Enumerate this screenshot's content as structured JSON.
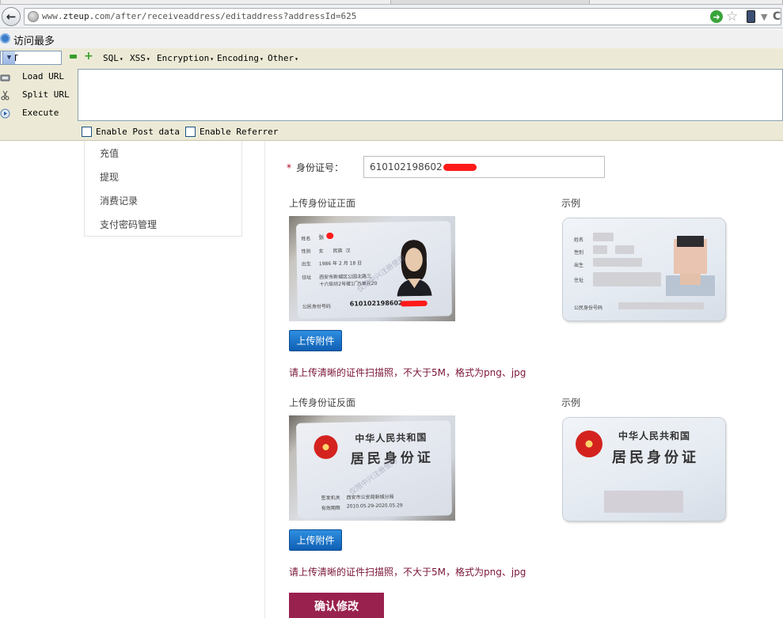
{
  "browser": {
    "url_prefix": "www.",
    "url_host": "zteup.",
    "url_rest": "com/after/receiveaddress/editaddress?addressId=625"
  },
  "bookmarks": {
    "most_visited": "访问最多"
  },
  "hackbar": {
    "select_value": "INT",
    "menus": [
      "SQL",
      "XSS",
      "Encryption",
      "Encoding",
      "Other"
    ],
    "load_url": "Load URL",
    "split_url": "Split URL",
    "execute": "Execute",
    "enable_post": "Enable Post data",
    "enable_referrer": "Enable Referrer"
  },
  "sidebar": {
    "items": [
      {
        "label": "充值"
      },
      {
        "label": "提现"
      },
      {
        "label": "消费记录"
      },
      {
        "label": "支付密码管理"
      }
    ]
  },
  "form": {
    "id_label": "身份证号：",
    "id_value": "610102198602",
    "front_title": "上传身份证正面",
    "back_title": "上传身份证反面",
    "example_label": "示例",
    "upload_label": "上传附件",
    "hint": "请上传清晰的证件扫描照，不大于5M，格式为png、jpg",
    "submit_label": "确认修改"
  },
  "card": {
    "front_id_number": "610102198602",
    "name_label": "姓名",
    "name_value": "张",
    "sex_label": "性别",
    "sex_value": "女",
    "ethnic_label": "民族",
    "ethnic_value": "汉",
    "birth_label": "出生",
    "birth_value": "1986 年 2 月 18 日",
    "address_label": "住址",
    "address_line1": "西安市新城区公园北路三",
    "address_line2": "十六街坊2号楼1门5单元20",
    "id_number_label": "公民身份号码",
    "country": "中华人民共和国",
    "card_name": "居民身份证",
    "authority_label": "签发机关",
    "authority_value": "西安市公安局新城分局",
    "validity_label": "有效期限",
    "validity_value": "2010.05.29-2020.05.29",
    "watermark": "仅限中兴注册使用"
  },
  "colors": {
    "accent_blue": "#0f5fb4",
    "submit_bg": "#99214d",
    "hint_text": "#7a1436",
    "required": "#b0001a"
  }
}
